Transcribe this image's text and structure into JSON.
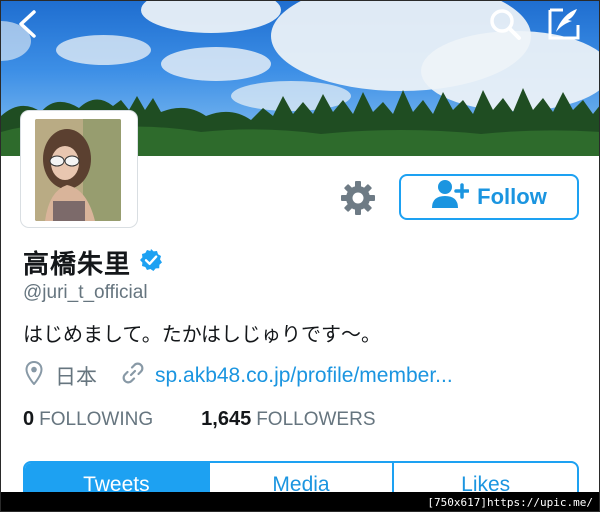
{
  "profile": {
    "name": "高橋朱里",
    "handle": "@juri_t_official",
    "bio": "はじめまして。たかはしじゅりです〜。",
    "location": "日本",
    "link": "sp.akb48.co.jp/profile/member..."
  },
  "actions": {
    "follow_label": "Follow"
  },
  "stats": {
    "following_count": "0",
    "following_label": "FOLLOWING",
    "followers_count": "1,645",
    "followers_label": "FOLLOWERS"
  },
  "tabs": [
    {
      "label": "Tweets",
      "active": true
    },
    {
      "label": "Media",
      "active": false
    },
    {
      "label": "Likes",
      "active": false
    }
  ],
  "icons": {
    "back": "back-arrow-icon",
    "search": "search-icon",
    "compose": "compose-icon",
    "settings": "gear-icon",
    "follow": "add-user-icon",
    "verified": "verified-badge-icon",
    "location": "location-pin-icon",
    "link": "link-icon"
  },
  "colors": {
    "accent": "#1da1f2",
    "link": "#1b95e0",
    "muted": "#66757f",
    "text": "#14171a"
  },
  "watermark": "[750x617]https://upic.me/"
}
